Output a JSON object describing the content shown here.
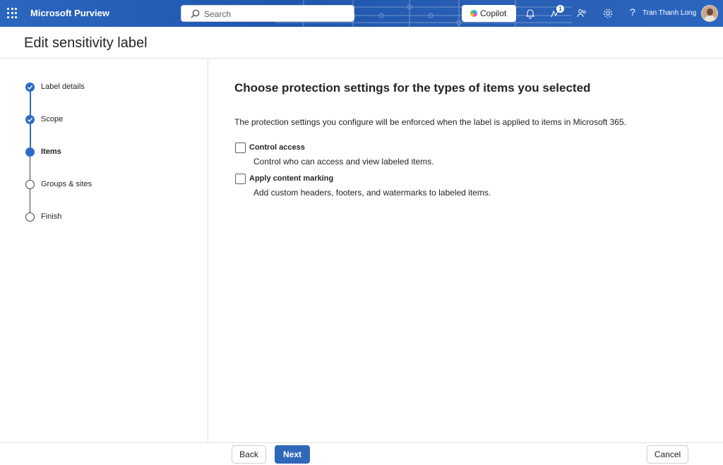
{
  "app": {
    "title": "Microsoft Purview"
  },
  "topbar": {
    "search_placeholder": "Search",
    "copilot_label": "Copilot",
    "notification_count": "1",
    "help_glyph": "?",
    "user_name": "Tran Thanh Long",
    "colors": {
      "bar": "#1f56ad",
      "accent": "#2b6cc4"
    }
  },
  "page": {
    "title": "Edit sensitivity label"
  },
  "steps": [
    {
      "label": "Label details",
      "state": "done"
    },
    {
      "label": "Scope",
      "state": "done"
    },
    {
      "label": "Items",
      "state": "current"
    },
    {
      "label": "Groups & sites",
      "state": "todo"
    },
    {
      "label": "Finish",
      "state": "todo"
    }
  ],
  "main": {
    "heading": "Choose protection settings for the types of items you selected",
    "description": "The protection settings you configure will be enforced when the label is applied to items in Microsoft 365.",
    "options": [
      {
        "title": "Control access",
        "description": "Control who can access and view labeled items.",
        "checked": false
      },
      {
        "title": "Apply content marking",
        "description": "Add custom headers, footers, and watermarks to labeled items.",
        "checked": false
      }
    ]
  },
  "footer": {
    "back_label": "Back",
    "next_label": "Next",
    "cancel_label": "Cancel"
  }
}
